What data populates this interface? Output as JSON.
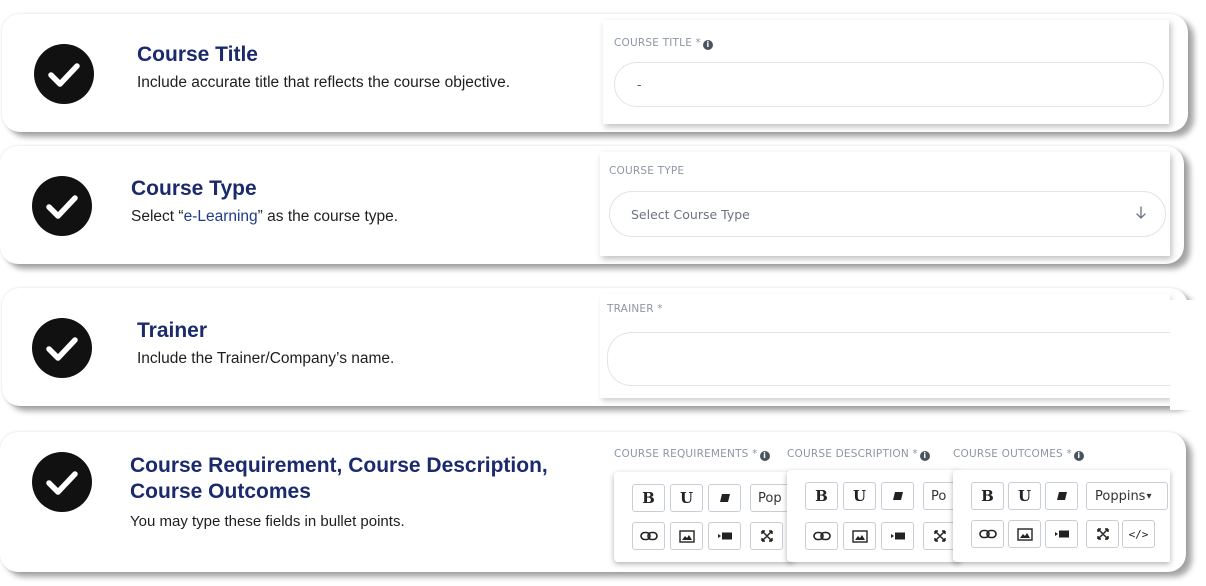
{
  "steps": [
    {
      "title": "Course Title",
      "description": "Include accurate title that reflects the course objective."
    },
    {
      "title": "Course Type",
      "description_pre": "Select “",
      "description_accent": "e-Learning",
      "description_post": "” as the course type."
    },
    {
      "title": "Trainer",
      "description": "Include the Trainer/Company’s name."
    },
    {
      "title_line1": "Course Requirement, Course Description,",
      "title_line2": "Course Outcomes",
      "description": "You may type these fields in bullet points."
    }
  ],
  "fields": {
    "course_title": {
      "label": "COURSE TITLE *",
      "value": "-"
    },
    "course_type": {
      "label": "COURSE TYPE",
      "placeholder": "Select Course Type"
    },
    "trainer": {
      "label": "TRAINER *",
      "value": ""
    },
    "editors": [
      {
        "label": "COURSE REQUIREMENTS *",
        "font_label": "Pop"
      },
      {
        "label": "COURSE DESCRIPTION *",
        "font_label": "Po"
      },
      {
        "label": "COURSE OUTCOMES *",
        "font_label": "Poppins"
      }
    ]
  },
  "toolbar": {
    "bold": "B",
    "underline": "U",
    "code": "</>",
    "info_glyph": "i",
    "dropdown_caret": "▾"
  },
  "colors": {
    "title": "#1a2a6c",
    "check_bg": "#111111",
    "label": "#8d96a3"
  }
}
